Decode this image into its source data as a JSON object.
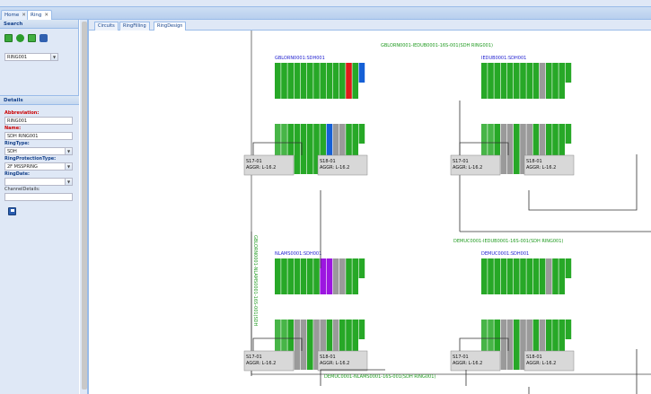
{
  "app": {
    "tabs": [
      {
        "label": "Home",
        "close": "✕"
      },
      {
        "label": "Ring",
        "close": "✕"
      }
    ]
  },
  "search": {
    "title": "Search",
    "ring_select": "RING001"
  },
  "details": {
    "title": "Details",
    "abbreviation_label": "Abbreviation:",
    "abbreviation_value": "RING001",
    "name_label": "Name:",
    "name_value": "SDH RING001",
    "ringtype_label": "RingType:",
    "ringtype_value": "SDH",
    "protection_label": "RingProtectionType:",
    "protection_value": "2F MSSPRING",
    "ringdate_label": "RingDate:",
    "ringdate_value": "",
    "channel_label": "ChannelDetails:",
    "channel_value": ""
  },
  "subtabs": [
    "Circuits",
    "RingFilling",
    "RingDesign"
  ],
  "diagram": {
    "links": {
      "top": "GBLORN0001-IEDUB0001-16S-001(SDH RING001)",
      "left": "GBLORN0001-NLAMS0001-16S-001(SDH",
      "right": "DEMUC0001-IEDUB0001-16S-001(SDH RING001)",
      "bottom": "DEMUC0001-NLAMS0001-16S-001(SDH RING001)"
    },
    "nodes": [
      {
        "name": "GBLORN0001:SDH001",
        "left_port": "S17-01",
        "left_aggr": "AGGR: L-16.2",
        "right_port": "S18-01",
        "right_aggr": "AGGR: L-16.2"
      },
      {
        "name": "IEDUB0001:SDH001",
        "left_port": "S17-01",
        "left_aggr": "AGGR: L-16.2",
        "right_port": "S18-01",
        "right_aggr": "AGGR: L-16.2"
      },
      {
        "name": "NLAMS0001:SDH001",
        "left_port": "S17-01",
        "left_aggr": "AGGR: L-16.2",
        "right_port": "S18-01",
        "right_aggr": "AGGR: L-16.2"
      },
      {
        "name": "DEMUC0001:SDH001",
        "left_port": "S17-01",
        "left_aggr": "AGGR: L-16.2",
        "right_port": "S18-01",
        "right_aggr": "AGGR: L-16.2"
      }
    ],
    "colors": {
      "slot": "#27a827",
      "used_red": "#e01a1a",
      "used_blue": "#1560d6",
      "used_purple": "#9c16e0",
      "grey": "#9a9a9a",
      "link": "#333333"
    },
    "icons": [
      "add-icon",
      "refresh-icon",
      "edit-icon",
      "binoculars-icon",
      "save-icon"
    ]
  }
}
